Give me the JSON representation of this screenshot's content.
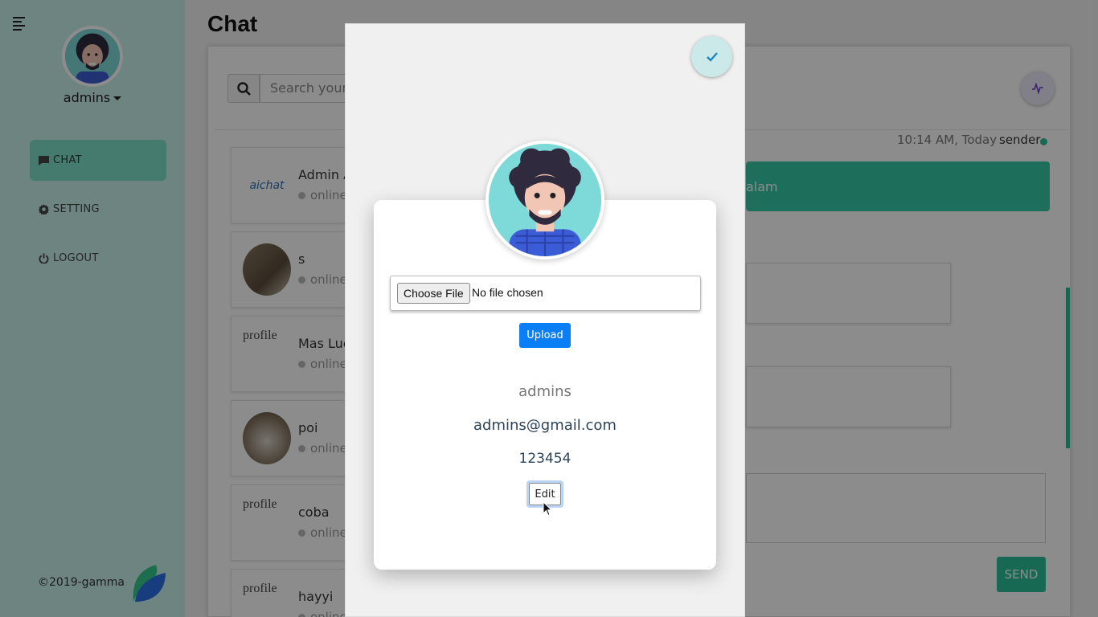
{
  "sidebar": {
    "username": "admins",
    "nav": [
      {
        "label": "CHAT",
        "icon": "chat-icon",
        "active": true
      },
      {
        "label": "SETTING",
        "icon": "gear-icon",
        "active": false
      },
      {
        "label": "LOGOUT",
        "icon": "power-icon",
        "active": false
      }
    ],
    "copyright": "©2019-gamma"
  },
  "main": {
    "title": "Chat",
    "search_placeholder": "Search your",
    "contacts": [
      {
        "name": "Admin A",
        "status": "online",
        "pic": "aichat"
      },
      {
        "name": "s",
        "status": "online",
        "pic": "photo"
      },
      {
        "name": "Mas Luc",
        "status": "online",
        "pic": "profile"
      },
      {
        "name": "poi",
        "status": "online",
        "pic": "photo"
      },
      {
        "name": "coba",
        "status": "online",
        "pic": "profile"
      },
      {
        "name": "hayyi",
        "status": "online",
        "pic": "profile"
      }
    ],
    "message_time": "10:14 AM, Today",
    "message_sender": "sender",
    "sent_message_fragment": "alam",
    "send_label": "SEND"
  },
  "modal": {
    "choose_file_label": "Choose File",
    "file_status": "No file chosen",
    "upload_label": "Upload",
    "profile_name": "admins",
    "profile_email": "admins@gmail.com",
    "profile_phone": "123454",
    "edit_label": "Edit"
  },
  "colors": {
    "sidebar_bg": "#c7f1ea",
    "accent": "#2dbf98",
    "active_nav": "#7fe0c8",
    "upload_blue": "#0a7ff5"
  }
}
